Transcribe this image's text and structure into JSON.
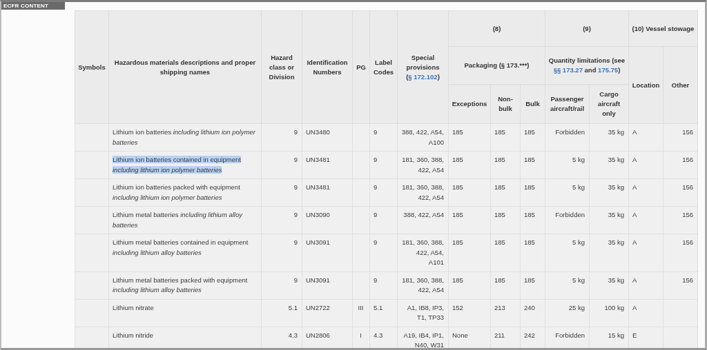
{
  "frame": {
    "label": "ECFR CONTENT"
  },
  "header": {
    "symbols": "Symbols",
    "description": "Hazardous materials descriptions and proper shipping names",
    "hazard_class": "Hazard class or Division",
    "identification": "Identification Numbers",
    "pg": "PG",
    "label_codes": "Label Codes",
    "special_provisions": [
      {
        "text": "Special provisions ("
      },
      {
        "text": "§ 172.102",
        "link": true
      },
      {
        "text": ")"
      }
    ],
    "group_8": "(8)",
    "group_9": "(9)",
    "group_10": "(10) Vessel stowage",
    "packaging": [
      {
        "text": "Packaging (§ 173.***)"
      }
    ],
    "quantity": [
      {
        "text": "Quantity limitations (see "
      },
      {
        "text": "§§ 173.27",
        "link": true
      },
      {
        "text": " and "
      },
      {
        "text": "175.75",
        "link": true
      },
      {
        "text": ")"
      }
    ],
    "exceptions": "Exceptions",
    "non_bulk": "Non-bulk",
    "bulk": "Bulk",
    "passenger": "Passenger aircraft/rail",
    "cargo": "Cargo aircraft only",
    "location": "Location",
    "other": "Other"
  },
  "rows": [
    {
      "description": "Lithium ion batteries *including lithium ion polymer batteries*",
      "hazard": "9",
      "id": "UN3480",
      "label": "9",
      "special": "388, 422, A54, A100",
      "exceptions": "185",
      "non_bulk": "185",
      "bulk": "185",
      "passenger": "Forbidden",
      "cargo": "35 kg",
      "location": "A",
      "other": "156",
      "selected": false
    },
    {
      "description": "Lithium ion batteries contained in equipment *including lithium ion polymer batteries*",
      "hazard": "9",
      "id": "UN3481",
      "label": "9",
      "special": "181, 360, 388, 422, A54",
      "exceptions": "185",
      "non_bulk": "185",
      "bulk": "185",
      "passenger": "5 kg",
      "cargo": "35 kg",
      "location": "A",
      "other": "156",
      "selected": true
    },
    {
      "description": "Lithium ion batteries packed with equipment *including lithium ion polymer batteries*",
      "hazard": "9",
      "id": "UN3481",
      "label": "9",
      "special": "181, 360, 388, 422, A54",
      "exceptions": "185",
      "non_bulk": "185",
      "bulk": "185",
      "passenger": "5 kg",
      "cargo": "35 kg",
      "location": "A",
      "other": "156",
      "selected": false
    },
    {
      "description": "Lithium metal batteries *including lithium alloy batteries*",
      "hazard": "9",
      "id": "UN3090",
      "label": "9",
      "special": "388, 422, A54",
      "exceptions": "185",
      "non_bulk": "185",
      "bulk": "185",
      "passenger": "Forbidden",
      "cargo": "35 kg",
      "location": "A",
      "other": "156",
      "selected": false
    },
    {
      "description": "Lithium metal batteries contained in equipment *including lithium alloy batteries*",
      "hazard": "9",
      "id": "UN3091",
      "label": "9",
      "special": "181, 360, 388, 422, A54, A101",
      "exceptions": "185",
      "non_bulk": "185",
      "bulk": "185",
      "passenger": "5 kg",
      "cargo": "35 kg",
      "location": "A",
      "other": "156",
      "selected": false
    },
    {
      "description": "Lithium metal batteries packed with equipment *including lithium alloy batteries*",
      "hazard": "9",
      "id": "UN3091",
      "label": "9",
      "special": "181, 360, 388, 422, A54",
      "exceptions": "185",
      "non_bulk": "185",
      "bulk": "185",
      "passenger": "5 kg",
      "cargo": "35 kg",
      "location": "A",
      "other": "156",
      "selected": false
    },
    {
      "description": "Lithium nitrate",
      "hazard": "5.1",
      "id": "UN2722",
      "pg": "III",
      "label": "5.1",
      "special": "A1, IB8, IP3, T1, TP33",
      "exceptions": "152",
      "non_bulk": "213",
      "bulk": "240",
      "passenger": "25 kg",
      "cargo": "100 kg",
      "location": "A",
      "selected": false
    },
    {
      "description": "Lithium nitride",
      "hazard": "4.3",
      "id": "UN2806",
      "pg": "I",
      "label": "4.3",
      "special": "A19, IB4, IP1, N40, W31",
      "exceptions": "None",
      "non_bulk": "211",
      "bulk": "242",
      "passenger": "Forbidden",
      "cargo": "15 kg",
      "location": "E",
      "selected": false
    }
  ]
}
